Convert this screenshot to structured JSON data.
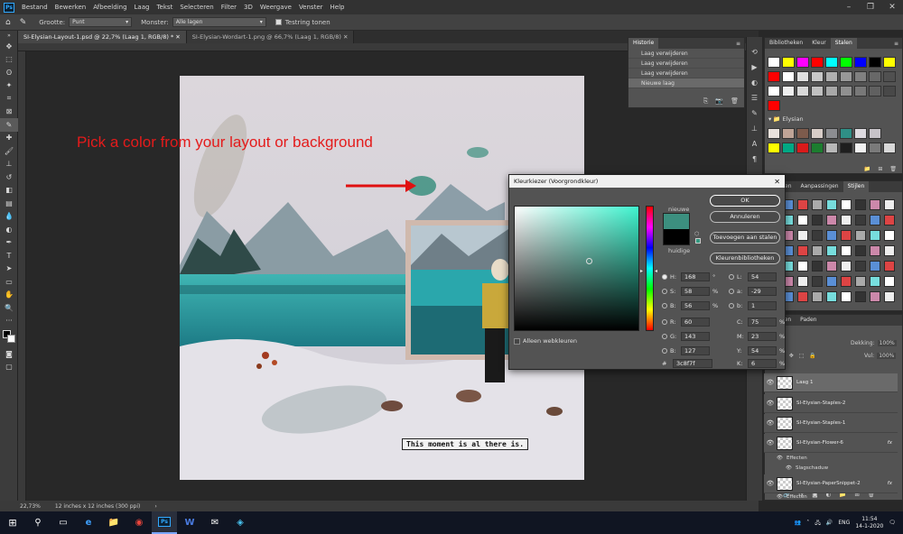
{
  "menubar": {
    "items": [
      "Bestand",
      "Bewerken",
      "Afbeelding",
      "Laag",
      "Tekst",
      "Selecteren",
      "Filter",
      "3D",
      "Weergave",
      "Venster",
      "Help"
    ]
  },
  "options": {
    "size_label": "Grootte:",
    "size_value": "Punt",
    "sample_label": "Monster:",
    "sample_value": "Alle lagen",
    "ring_label": "Testring tonen"
  },
  "tabs": [
    {
      "label": "SI-Elysian-Layout-1.psd @ 22,7% (Laag 1, RGB/8) *"
    },
    {
      "label": "SI-Elysian-Wordart-1.png @ 66,7% (Laag 1, RGB/8)"
    }
  ],
  "document": {
    "annotation": "Pick a color from your layout or background",
    "wordart": "This moment is al there is."
  },
  "status": {
    "zoom": "22,73%",
    "size": "12 inches x 12 inches (300 ppi)"
  },
  "history": {
    "title": "Historie",
    "items": [
      "Laag verwijderen",
      "Laag verwijderen",
      "Laag verwijderen",
      "Nieuwe laag"
    ]
  },
  "swatches_panel": {
    "tabs": [
      "Bibliotheken",
      "Kleur",
      "Stalen"
    ],
    "group": "Elysian"
  },
  "styles_panel": {
    "tabs": [
      "...oppen",
      "Aanpassingen",
      "Stijlen"
    ]
  },
  "layers_panel": {
    "tabs": [
      "Kanalen",
      "Paden"
    ],
    "opacity_label": "Dekking:",
    "opacity_value": "100%",
    "fill_label": "Vul:",
    "fill_value": "100%",
    "layers": [
      {
        "name": "Laag 1",
        "selected": true
      },
      {
        "name": "SI-Elysian-Staples-2",
        "selected": false
      },
      {
        "name": "SI-Elysian-Staples-1",
        "selected": false
      },
      {
        "name": "SI-Elysian-Flower-6",
        "selected": false,
        "fx": "fx"
      },
      {
        "name": "SI-Elysian-PaperSnippet-2",
        "selected": false,
        "fx": "fx"
      }
    ],
    "effects_label": "Effecten",
    "shadow_label": "Slagschaduw",
    "effects_label_2": "Effecten"
  },
  "picker": {
    "title": "Kleurkiezer (Voorgrondkleur)",
    "new_label": "nieuwe",
    "current_label": "huidige",
    "ok": "OK",
    "cancel": "Annuleren",
    "add_swatch": "Toevoegen aan stalen",
    "libraries": "Kleurenbibliotheken",
    "web_only": "Alleen webkleuren",
    "new_color": "#3c8f7f",
    "current_color": "#000000",
    "H": "168",
    "H_unit": "°",
    "S": "58",
    "S_unit": "%",
    "B": "56",
    "B_unit": "%",
    "R": "60",
    "G": "143",
    "Bv": "127",
    "L": "54",
    "a": "-29",
    "b": "1",
    "C": "75",
    "M": "23",
    "Y": "54",
    "K": "6",
    "pct": "%",
    "hex_label": "#",
    "hex": "3c8f7f"
  },
  "taskbar": {
    "lang": "ENG",
    "time": "11:54",
    "date": "14-1-2020"
  }
}
